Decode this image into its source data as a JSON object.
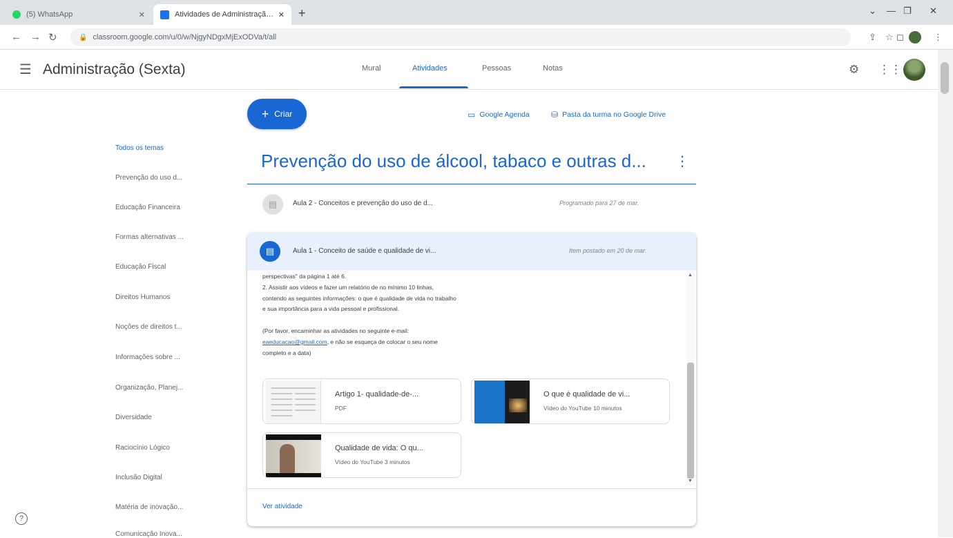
{
  "browser": {
    "tabs": [
      {
        "title": "(5) WhatsApp",
        "favicon": "whatsapp-icon"
      },
      {
        "title": "Atividades de Administração (Se",
        "favicon": "classroom-icon"
      }
    ],
    "new_tab": "+",
    "url": "classroom.google.com/u/0/w/NjgyNDgxMjExODVa/t/all"
  },
  "header": {
    "class_title": "Administração (Sexta)",
    "tabs": [
      "Mural",
      "Atividades",
      "Pessoas",
      "Notas"
    ],
    "active_tab": "Atividades"
  },
  "toolbar": {
    "create_label": "Criar",
    "calendar_link": "Google Agenda",
    "drive_link": "Pasta da turma no Google Drive"
  },
  "topics": [
    "Todos os temas",
    "Prevenção do uso d...",
    "Educação Financeira",
    "Formas alternativas ...",
    "Educação Fiscal",
    "Direitos Humanos",
    "Noções de direitos t...",
    "Informações sobre ...",
    "Organização, Planej...",
    "Diversidade",
    "Raciocínio Lógico",
    "Inclusão Digital",
    "Matéria de inovação...",
    "Comunicação Inova..."
  ],
  "topic_heading": "Prevenção do uso de álcool, tabaco e outras d...",
  "assignments": [
    {
      "title": "Aula 2 - Conceitos e prevenção do uso de d...",
      "meta": "Programado para 27 de mar."
    },
    {
      "title": "Aula 1 - Conceito de saúde e qualidade de vi...",
      "meta": "Item postado em 20 de mar."
    }
  ],
  "description": {
    "line1": "perspectivas\" da página 1 até 6.",
    "line2": "2. Assistir aos vídeos e fazer um relatório de no mínimo 10 linhas,",
    "line3": "contendo as seguintes informações: o que é qualidade de vida no trabalho",
    "line4": "e sua importância para a vida pessoal e profissional.",
    "line5": "(Por favor, encaminhar as atividades no seguinte e-mail:",
    "email": "eaeducacao@gmail.com",
    "line6_rest": ", e não se esqueça de colocar o seu nome",
    "line7": "completo e a data)"
  },
  "attachments": [
    {
      "title": "Artigo 1- qualidade-de-...",
      "sub": "PDF"
    },
    {
      "title": "O que é qualidade de vi...",
      "sub": "Vídeo do YouTube   10 minutos"
    },
    {
      "title": "Qualidade de vida: O qu...",
      "sub": "Vídeo do YouTube   3 minutos"
    }
  ],
  "view_activity": "Ver atividade"
}
